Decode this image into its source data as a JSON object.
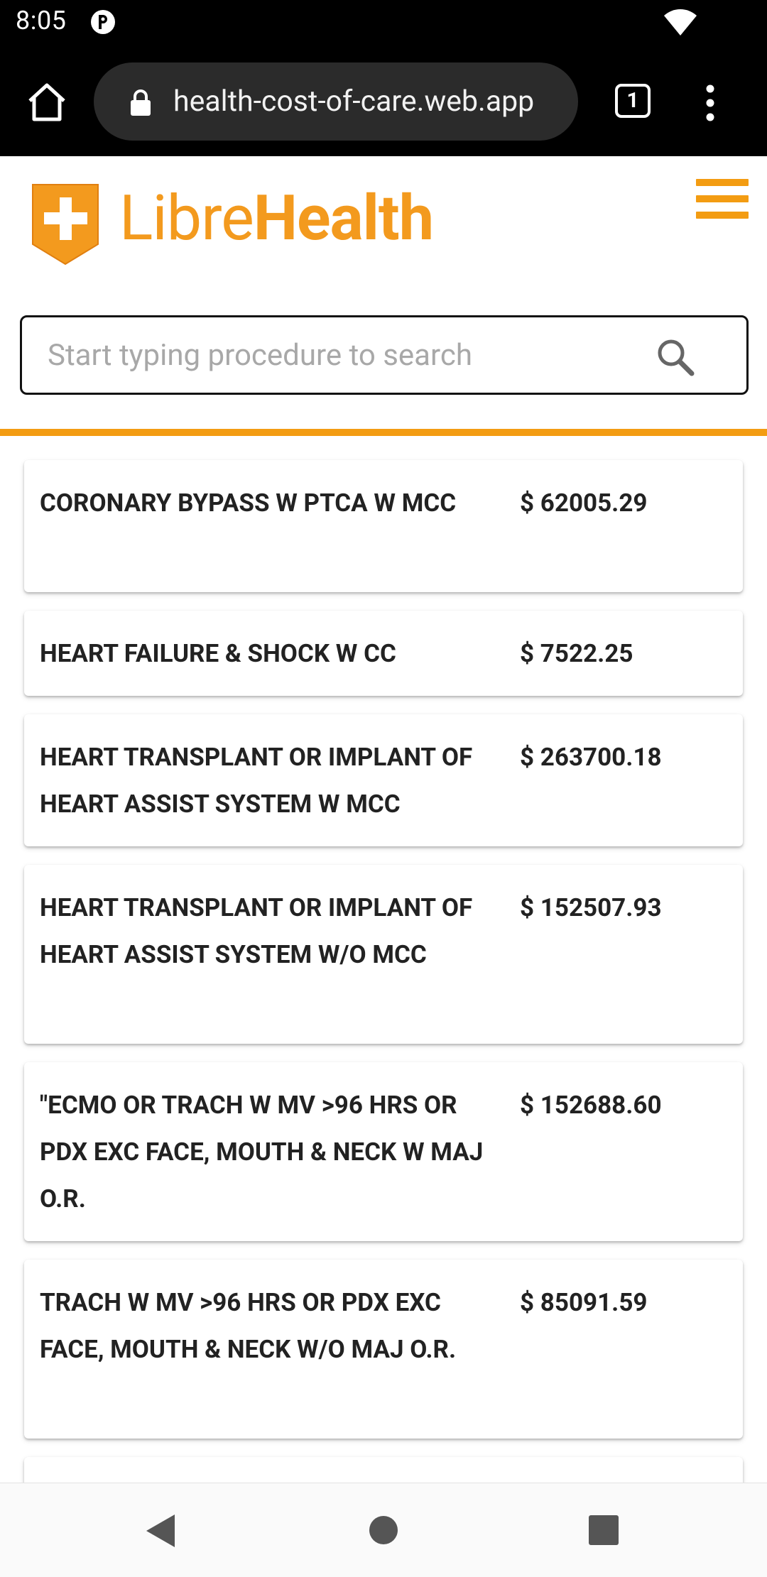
{
  "status_bar": {
    "time": "8:05",
    "icons": [
      "app-notification-icon",
      "wifi-icon"
    ]
  },
  "browser": {
    "url": "health-cost-of-care.web.app",
    "tab_count": "1",
    "icons": [
      "home-icon",
      "lock-icon",
      "more-vert-icon"
    ]
  },
  "header": {
    "logo_light": "Libre",
    "logo_bold": "Health",
    "brand_color": "#f39a1e",
    "menu_icon": "hamburger-menu-icon"
  },
  "search": {
    "placeholder": "Start typing procedure to search",
    "value": "",
    "icon": "search-icon"
  },
  "results": [
    {
      "name": "CORONARY BYPASS W PTCA W MCC",
      "price": "$ 62005.29"
    },
    {
      "name": "HEART FAILURE & SHOCK W CC",
      "price": "$ 7522.25"
    },
    {
      "name": "HEART TRANSPLANT OR IMPLANT OF HEART ASSIST SYSTEM W MCC",
      "price": "$ 263700.18"
    },
    {
      "name": "HEART TRANSPLANT OR IMPLANT OF HEART ASSIST SYSTEM W/O MCC",
      "price": "$ 152507.93"
    },
    {
      "name": "\"ECMO OR TRACH W MV >96 HRS OR PDX EXC FACE, MOUTH & NECK W MAJ O.R.",
      "price": "$ 152688.60"
    },
    {
      "name": "TRACH W MV >96 HRS OR PDX EXC FACE, MOUTH & NECK W/O MAJ O.R.",
      "price": "$ 85091.59"
    }
  ],
  "nav_bar": {
    "icons": [
      "back-icon",
      "home-circle-icon",
      "recents-square-icon"
    ]
  }
}
